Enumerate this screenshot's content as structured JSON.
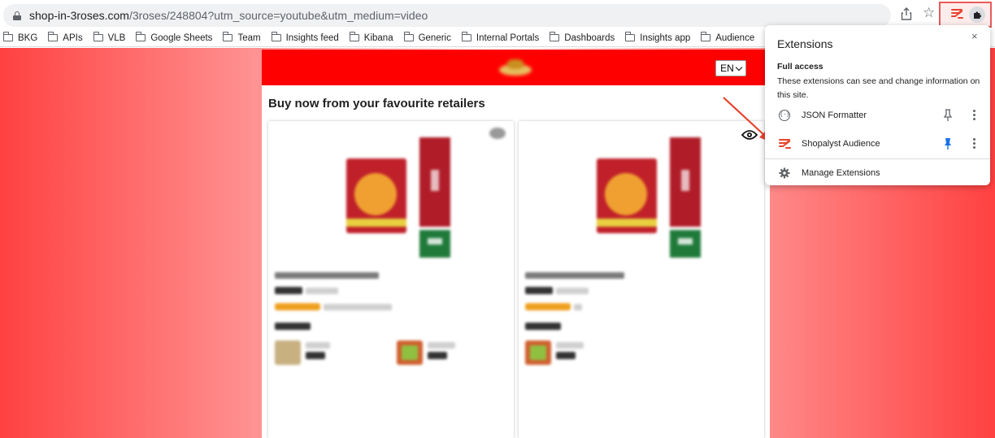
{
  "browser": {
    "url_host": "shop-in-3roses.com",
    "url_path": "/3roses/248804?utm_source=youtube&utm_medium=video",
    "icons": {
      "lock": "lock-icon",
      "share": "share-icon",
      "bookmark_star": "star-icon",
      "extension": "shopalyst-icon",
      "extensions_menu": "puzzle-icon"
    }
  },
  "bookmarks": [
    {
      "label": "BKG"
    },
    {
      "label": "APIs"
    },
    {
      "label": "VLB"
    },
    {
      "label": "Google Sheets"
    },
    {
      "label": "Team"
    },
    {
      "label": "Insights feed"
    },
    {
      "label": "Kibana"
    },
    {
      "label": "Generic"
    },
    {
      "label": "Internal Portals"
    },
    {
      "label": "Dashboards"
    },
    {
      "label": "Insights app"
    },
    {
      "label": "Audience"
    }
  ],
  "store": {
    "language": "EN",
    "headline": "Buy now from your favourite retailers"
  },
  "extensions_popup": {
    "title": "Extensions",
    "close": "×",
    "section_title": "Full access",
    "section_desc": "These extensions can see and change information on this site.",
    "items": [
      {
        "name": "JSON Formatter",
        "icon": "json-icon",
        "pinned": false
      },
      {
        "name": "Shopalyst Audience",
        "icon": "shopalyst-icon",
        "pinned": true
      }
    ],
    "manage": "Manage Extensions"
  },
  "colors": {
    "brand_red": "#ff0000",
    "highlight": "#e85a5a",
    "pin_active": "#1a73e8",
    "arrow": "#e8432e"
  }
}
